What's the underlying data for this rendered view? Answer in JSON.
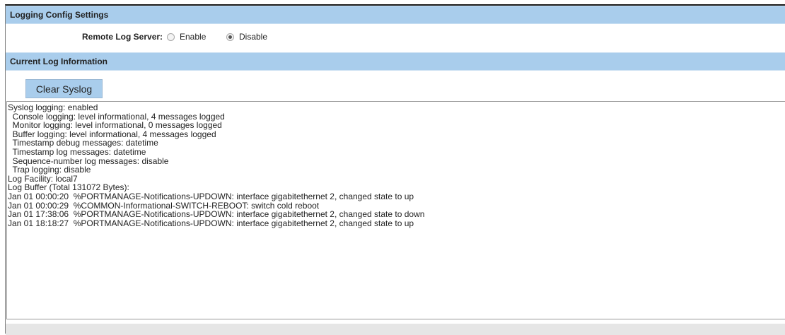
{
  "logging_config": {
    "header": "Logging Config Settings",
    "remote_log_server": {
      "label": "Remote Log Server:",
      "options": [
        "Enable",
        "Disable"
      ],
      "selected": "Disable"
    }
  },
  "current_log": {
    "header": "Current Log Information",
    "clear_button": "Clear Syslog",
    "lines": [
      "Syslog logging: enabled",
      "  Console logging: level informational, 4 messages logged",
      "  Monitor logging: level informational, 0 messages logged",
      "  Buffer logging: level informational, 4 messages logged",
      "  Timestamp debug messages: datetime",
      "  Timestamp log messages: datetime",
      "  Sequence-number log messages: disable",
      "  Trap logging: disable",
      "Log Facility: local7",
      "Log Buffer (Total 131072 Bytes):",
      "Jan 01 00:00:20  %PORTMANAGE-Notifications-UPDOWN: interface gigabitethernet 2, changed state to up",
      "Jan 01 00:00:29  %COMMON-Informational-SWITCH-REBOOT: switch cold reboot",
      "Jan 01 17:38:06  %PORTMANAGE-Notifications-UPDOWN: interface gigabitethernet 2, changed state to down",
      "Jan 01 18:18:27  %PORTMANAGE-Notifications-UPDOWN: interface gigabitethernet 2, changed state to up"
    ]
  },
  "colors": {
    "header_bg": "#a9cdec",
    "button_bg": "#a9cdec",
    "footer_bg": "#e6e6e6"
  }
}
